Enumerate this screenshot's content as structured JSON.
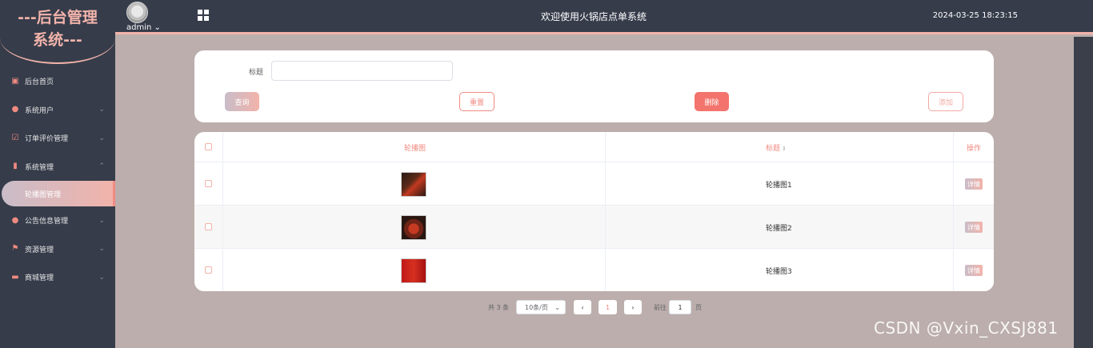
{
  "brand": {
    "line1": "---后台管理",
    "line2": "系统---"
  },
  "header": {
    "user": "admin",
    "user_caret": "⌄",
    "title": "欢迎使用火锅店点单系统",
    "datetime": "2024-03-25 18:23:15"
  },
  "sidebar": {
    "items": [
      {
        "label": "后台首页",
        "icon": "▣",
        "icon_name": "monitor-icon",
        "chevron": ""
      },
      {
        "label": "系统用户",
        "icon": "●",
        "icon_name": "user-icon",
        "chevron": "⌄"
      },
      {
        "label": "订单评价管理",
        "icon": "☑",
        "icon_name": "checkbox-icon",
        "chevron": "⌄"
      },
      {
        "label": "系统管理",
        "icon": "▮",
        "icon_name": "bar-chart-icon",
        "chevron": "⌃"
      },
      {
        "label": "轮播图管理",
        "sub": true
      },
      {
        "label": "公告信息管理",
        "icon": "●",
        "icon_name": "info-icon",
        "chevron": "⌄"
      },
      {
        "label": "资源管理",
        "icon": "⚑",
        "icon_name": "flag-icon",
        "chevron": "⌄"
      },
      {
        "label": "商城管理",
        "icon": "▬",
        "icon_name": "shop-icon",
        "chevron": "⌄"
      }
    ]
  },
  "search": {
    "label": "标题",
    "value": "",
    "placeholder": ""
  },
  "buttons": {
    "query": "查询",
    "reset": "重置",
    "delete": "删除",
    "add": "添加"
  },
  "table": {
    "headers": {
      "image": "轮播图",
      "title": "标题",
      "sort": "⇕",
      "action": "操作"
    },
    "rows": [
      {
        "title": "轮播图1",
        "action": "详情"
      },
      {
        "title": "轮播图2",
        "action": "详情"
      },
      {
        "title": "轮播图3",
        "action": "详情"
      }
    ]
  },
  "pagination": {
    "total": "共 3 条",
    "page_size": "10条/页",
    "size_caret": "⌄",
    "prev": "‹",
    "current": "1",
    "next": "›",
    "goto": "前往",
    "goto_value": "1",
    "page_suffix": "页"
  },
  "watermark": "CSDN @Vxin_CXSJ881"
}
